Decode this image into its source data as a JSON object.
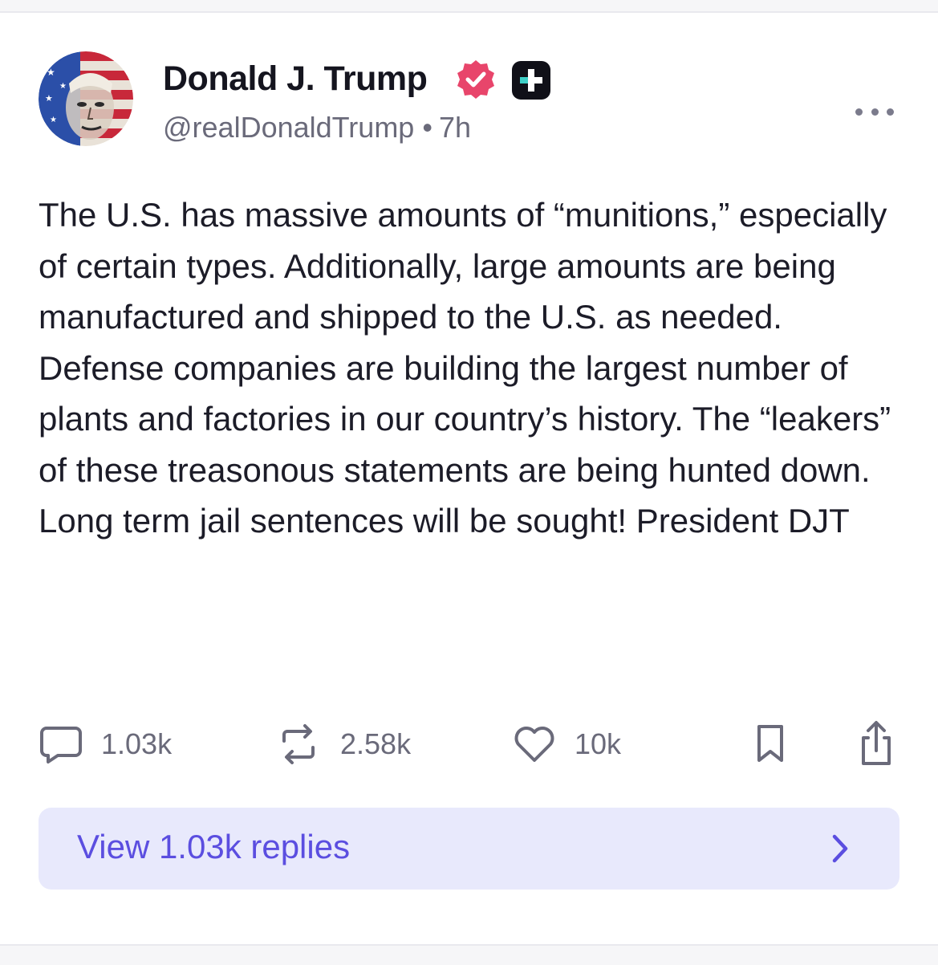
{
  "post": {
    "display_name": "Donald J. Trump",
    "handle": "@realDonaldTrump",
    "separator": "•",
    "time": "7h",
    "body": "The U.S. has massive amounts of “munitions,” especially of certain types. Additionally, large amounts are being manufactured and shipped to the U.S. as needed. Defense companies are building the largest number of plants and factories in our country’s history. The “leakers” of these treasonous statements are being hunted down. Long term jail sentences will be sought! President DJT",
    "badges": {
      "verified_icon": "verified-badge-icon",
      "verified_color": "#e8456b",
      "plus_icon": "plus-badge-icon",
      "plus_color": "#101018"
    }
  },
  "actions": {
    "replies": "1.03k",
    "reposts": "2.58k",
    "likes": "10k",
    "icons": [
      "comment-icon",
      "repost-icon",
      "heart-icon",
      "bookmark-icon",
      "share-icon"
    ]
  },
  "view_replies": {
    "label": "View 1.03k replies",
    "accent": "#5b4ee0",
    "background": "#e8e9fc"
  },
  "more_menu_icon": "more-horizontal-icon"
}
